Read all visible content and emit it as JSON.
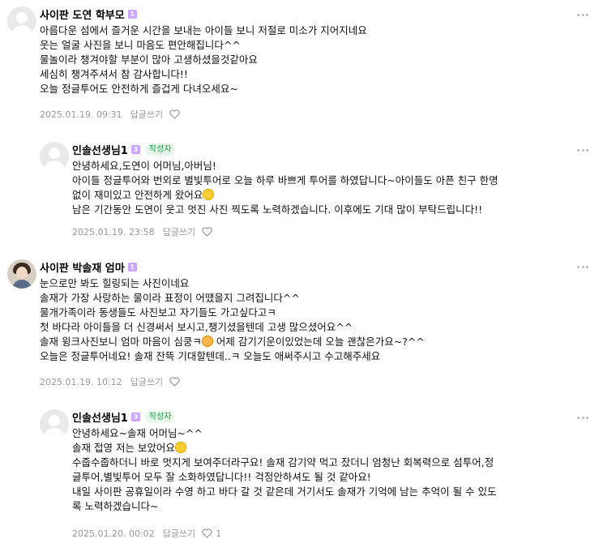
{
  "comments": [
    {
      "nickname": "사이판 도연 학부모",
      "level": "1",
      "lines": [
        "아름다운 섬에서 즐거운 시간을 보내는 아이들 보니 저절로 미소가 지어지네요",
        "웃는 얼굴 사진을 보니 마음도 편안해집니다^^",
        "물놀이라 챙겨야할 부분이 많아 고생하셨을것같아요",
        "세심히 챙겨주셔서 참 감사합니다!!",
        "오늘 정글투어도 안전하게 즐겁게 다녀오세요~"
      ],
      "date": "2025.01.19. 09:31",
      "reply_label": "답글쓰기",
      "likes": ""
    },
    {
      "nickname": "인솔선생님1",
      "level": "3",
      "badge": "작성자",
      "lines": [
        "안녕하세요,도연이 어머님,아버님!",
        "아이들 정글투어와 번외로 별빛투어로 오늘 하루 바쁘게 투어를 하였답니다~아이들도 아픈 친구 한명",
        "없이 재미있고 안전하게 왔어요",
        "남은 기간동안 도연이 웃고 멋진 사진 찍도록 노력하겠습니다. 이후에도 기대 많이 부탁드립니다!!"
      ],
      "date": "2025.01.19. 23:58",
      "reply_label": "답글쓰기",
      "likes": ""
    },
    {
      "nickname": "사이판 박솔재 엄마",
      "level": "1",
      "lines": [
        "눈으로만 봐도 힐링되는 사진이네요",
        "솔재가 가장 사랑하는 물이라 표정이 어땠을지 그려집니다^^",
        "물개가족이라 동생들도 사진보고 자기들도 가고싶다고ㅋ",
        "첫 바다라 아이들을 더 신경써서 보시고,챙기셨을텐데 고생 많으셨어요^^",
        "솔재 윙크사진보니 엄마 마음이 심쿵ㅋ",
        " 어제 감기기운이있었는데 오늘 괜찮은가요~?^^",
        "오늘은 정글투어네요! 솔재 잔뜩 기대할텐데..ㅋ 오늘도 애써주시고 수고해주세요"
      ],
      "date": "2025.01.19. 10:12",
      "reply_label": "답글쓰기",
      "likes": ""
    },
    {
      "nickname": "인솔선생님1",
      "level": "3",
      "badge": "작성자",
      "lines": [
        "안녕하세요~솔재 어머님~^^",
        "솔재 접영 저는 보았어요",
        "수줍수줍하더니 바로 멋지게 보여주더라구요! 솔재 감기약 먹고 잤더니 엄청난 회복력으로 섬투어,정",
        "글투어,별빛투어 모두 잘 소화하였답니다!! 걱정안하셔도 될 것 같아요!",
        "내일 사이판 공휴일이라 수영 하고 바다 갈 것 같은데 거기서도 솔재가 기억에 남는 추억이 될 수 있도",
        "록 노력하겠습니다~"
      ],
      "date": "2025.01.20. 00:02",
      "reply_label": "답글쓰기",
      "likes": "1"
    }
  ],
  "icons": {
    "more": "more-dots-icon",
    "heart": "heart-icon",
    "avatar_default": "default-avatar-icon"
  },
  "colors": {
    "level_badge": "#c9a6ff",
    "author_badge_text": "#17a34a",
    "author_badge_bg": "#e8f7ea",
    "meta_text": "#999999"
  }
}
